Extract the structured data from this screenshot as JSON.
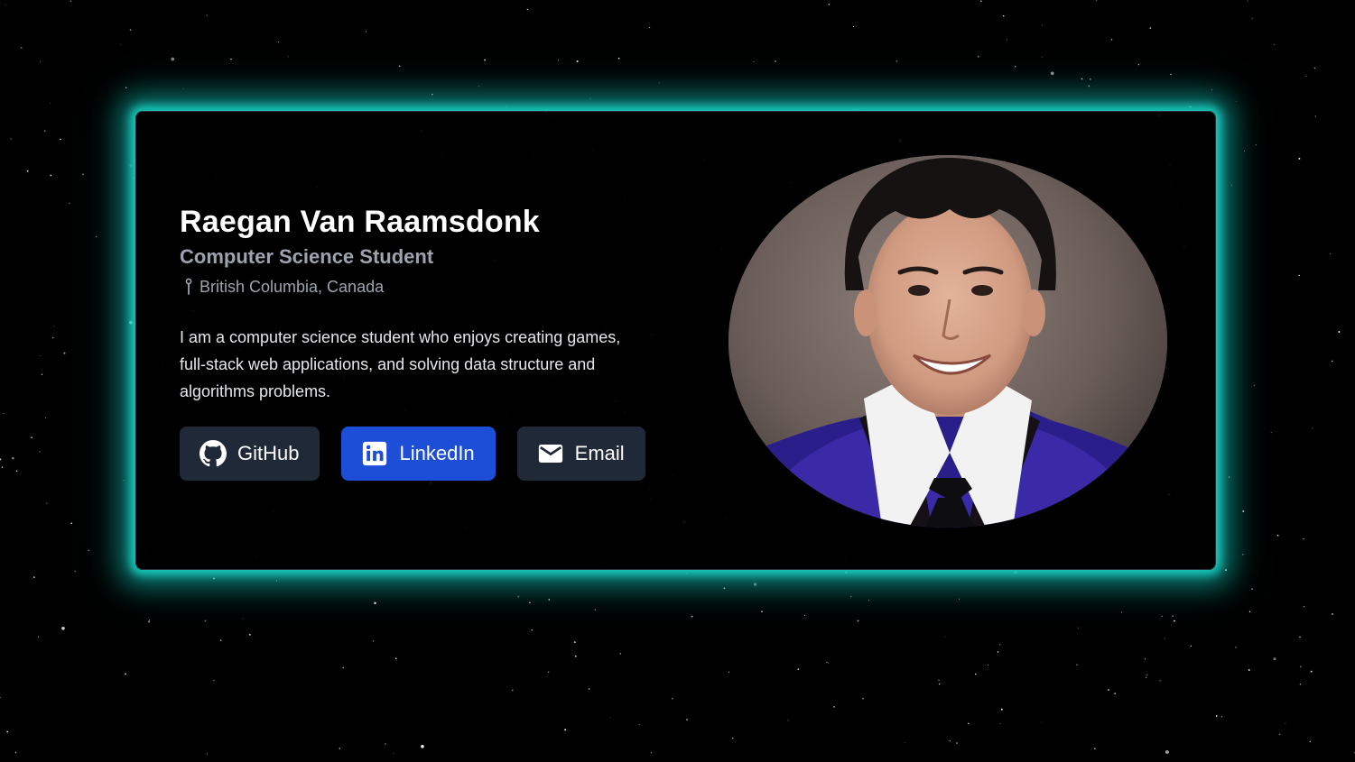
{
  "profile": {
    "name": "Raegan Van Raamsdonk",
    "role": "Computer Science Student",
    "location": "British Columbia, Canada",
    "bio": "I am a computer science student who enjoys creating games, full-stack web applications, and solving data structure and algorithms problems."
  },
  "links": {
    "github": {
      "label": "GitHub",
      "icon": "github-icon"
    },
    "linkedin": {
      "label": "LinkedIn",
      "icon": "linkedin-icon"
    },
    "email": {
      "label": "Email",
      "icon": "mail-icon"
    }
  },
  "theme": {
    "glow": "#18d4c6",
    "button_dark": "#1f2937",
    "button_blue": "#1d4ed8",
    "muted_text": "#9ca3af"
  },
  "photo": {
    "alt": "Raegan Van Raamsdonk"
  }
}
